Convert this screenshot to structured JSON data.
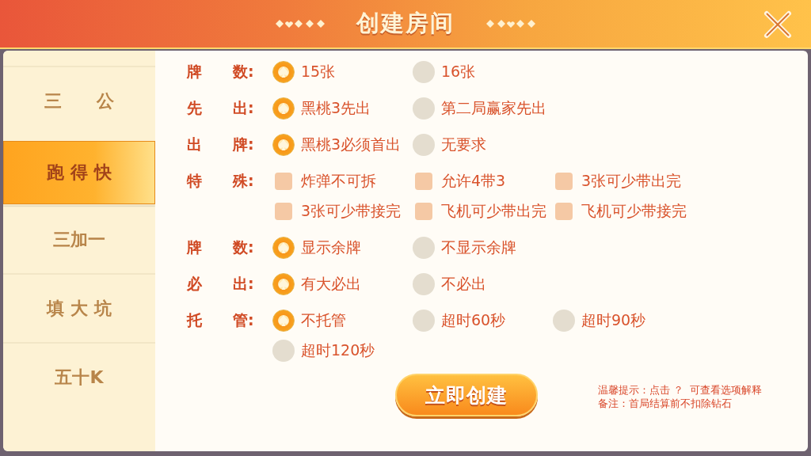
{
  "window": {
    "title": "创建房间"
  },
  "sidebar": {
    "items": [
      {
        "label": "三　　公",
        "selected": false
      },
      {
        "label": "跑 得 快",
        "selected": true
      },
      {
        "label": "三加一",
        "selected": false
      },
      {
        "label": "填 大 坑",
        "selected": false
      },
      {
        "label": "五十K",
        "selected": false
      }
    ]
  },
  "settings": [
    {
      "label": "牌",
      "suffix": "数:",
      "kind": "radio",
      "options": [
        {
          "label": "15张",
          "selected": true
        },
        {
          "label": "16张",
          "selected": false
        }
      ]
    },
    {
      "label": "先",
      "suffix": "出:",
      "kind": "radio",
      "options": [
        {
          "label": "黑桃3先出",
          "selected": true
        },
        {
          "label": "第二局赢家先出",
          "selected": false
        }
      ]
    },
    {
      "label": "出",
      "suffix": "牌:",
      "kind": "radio",
      "options": [
        {
          "label": "黑桃3必须首出",
          "selected": true
        },
        {
          "label": "无要求",
          "selected": false
        }
      ]
    },
    {
      "label": "特",
      "suffix": "殊:",
      "kind": "checkbox",
      "options": [
        {
          "label": "炸弹不可拆",
          "checked": false
        },
        {
          "label": "允许4带3",
          "checked": false
        },
        {
          "label": "3张可少带出完",
          "checked": false
        },
        {
          "label": "3张可少带接完",
          "checked": false
        },
        {
          "label": "飞机可少带出完",
          "checked": false
        },
        {
          "label": "飞机可少带接完",
          "checked": false
        }
      ]
    },
    {
      "label": "牌",
      "suffix": "数:",
      "kind": "radio",
      "options": [
        {
          "label": "显示余牌",
          "selected": true
        },
        {
          "label": "不显示余牌",
          "selected": false
        }
      ]
    },
    {
      "label": "必",
      "suffix": "出:",
      "kind": "radio",
      "options": [
        {
          "label": "有大必出",
          "selected": true
        },
        {
          "label": "不必出",
          "selected": false
        }
      ]
    },
    {
      "label": "托",
      "suffix": "管:",
      "kind": "radio",
      "options": [
        {
          "label": "不托管",
          "selected": true
        },
        {
          "label": "超时60秒",
          "selected": false
        },
        {
          "label": "超时90秒",
          "selected": false
        },
        {
          "label": "超时120秒",
          "selected": false
        }
      ]
    }
  ],
  "create_button": "立即创建",
  "notes": [
    "温馨提示：点击 ？  可查看选项解释",
    "备注：首局结算前不扣除钻石"
  ]
}
